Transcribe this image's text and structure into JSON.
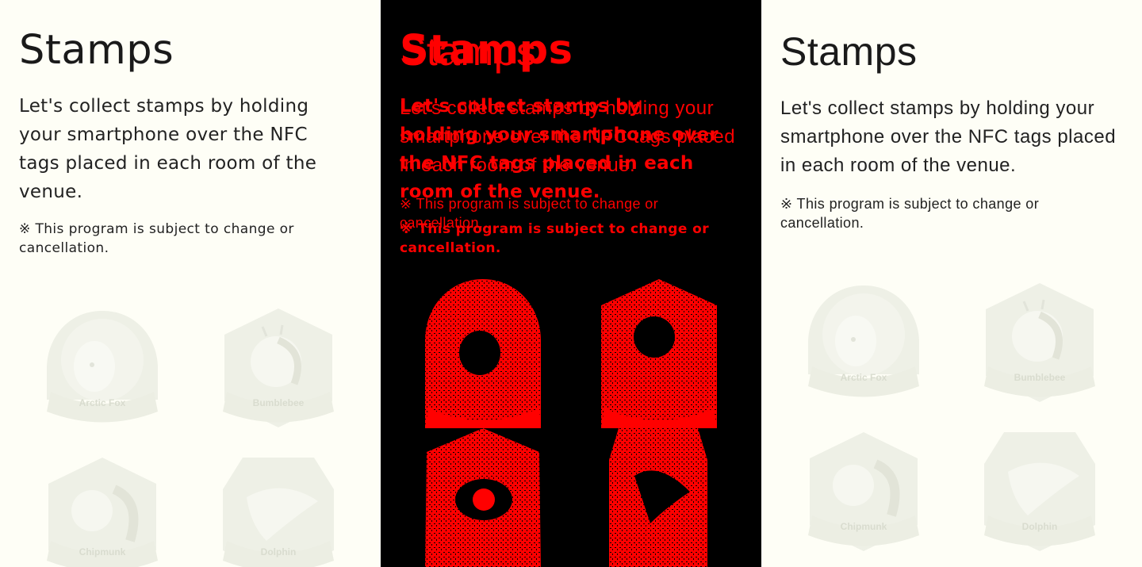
{
  "left": {
    "title": "Stamps",
    "description": "Let's collect stamps by holding your smartphone over the NFC tags placed in each room of the venue.",
    "note": "※ This program is subject to change or cancellation."
  },
  "right": {
    "title": "Stamps",
    "description": "Let's collect stamps by holding your smartphone over the NFC tags placed in each room of the venue.",
    "note": "※ This program is subject to change or cancellation."
  },
  "stamps": [
    {
      "label": "Arctic Fox",
      "icon": "arctic-fox-icon"
    },
    {
      "label": "Bumblebee",
      "icon": "bumblebee-icon"
    },
    {
      "label": "Chipmunk",
      "icon": "chipmunk-icon"
    },
    {
      "label": "Dolphin",
      "icon": "dolphin-icon"
    }
  ],
  "colors": {
    "page_background": "#fefef6",
    "text": "#222222",
    "stamp_faded": "#e8ebe0",
    "diff_background": "#000000",
    "diff_highlight": "#ff0000"
  }
}
